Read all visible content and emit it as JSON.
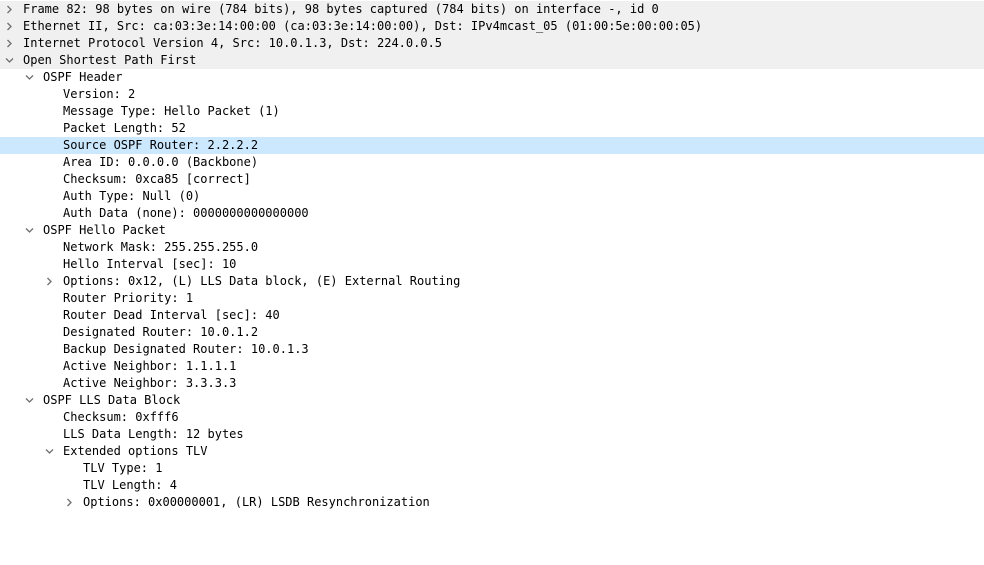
{
  "rows": [
    {
      "id": "frame",
      "text": "Frame 82: 98 bytes on wire (784 bits), 98 bytes captured (784 bits) on interface -, id 0",
      "depth": 0,
      "expander": "collapsed",
      "selected": false,
      "shaded": true
    },
    {
      "id": "ethernet",
      "text": "Ethernet II, Src: ca:03:3e:14:00:00 (ca:03:3e:14:00:00), Dst: IPv4mcast_05 (01:00:5e:00:00:05)",
      "depth": 0,
      "expander": "collapsed",
      "selected": false,
      "shaded": true
    },
    {
      "id": "ipv4",
      "text": "Internet Protocol Version 4, Src: 10.0.1.3, Dst: 224.0.0.5",
      "depth": 0,
      "expander": "collapsed",
      "selected": false,
      "shaded": true
    },
    {
      "id": "ospf",
      "text": "Open Shortest Path First",
      "depth": 0,
      "expander": "expanded",
      "selected": false,
      "shaded": true
    },
    {
      "id": "ospf-header",
      "text": "OSPF Header",
      "depth": 1,
      "expander": "expanded",
      "selected": false
    },
    {
      "id": "version",
      "text": "Version: 2",
      "depth": 2,
      "expander": "none",
      "selected": false
    },
    {
      "id": "message-type",
      "text": "Message Type: Hello Packet (1)",
      "depth": 2,
      "expander": "none",
      "selected": false
    },
    {
      "id": "packet-length",
      "text": "Packet Length: 52",
      "depth": 2,
      "expander": "none",
      "selected": false
    },
    {
      "id": "source-router",
      "text": "Source OSPF Router: 2.2.2.2",
      "depth": 2,
      "expander": "none",
      "selected": true
    },
    {
      "id": "area-id",
      "text": "Area ID: 0.0.0.0 (Backbone)",
      "depth": 2,
      "expander": "none",
      "selected": false
    },
    {
      "id": "checksum",
      "text": "Checksum: 0xca85 [correct]",
      "depth": 2,
      "expander": "none",
      "selected": false
    },
    {
      "id": "auth-type",
      "text": "Auth Type: Null (0)",
      "depth": 2,
      "expander": "none",
      "selected": false
    },
    {
      "id": "auth-data",
      "text": "Auth Data (none): 0000000000000000",
      "depth": 2,
      "expander": "none",
      "selected": false
    },
    {
      "id": "hello-packet",
      "text": "OSPF Hello Packet",
      "depth": 1,
      "expander": "expanded",
      "selected": false
    },
    {
      "id": "network-mask",
      "text": "Network Mask: 255.255.255.0",
      "depth": 2,
      "expander": "none",
      "selected": false
    },
    {
      "id": "hello-interval",
      "text": "Hello Interval [sec]: 10",
      "depth": 2,
      "expander": "none",
      "selected": false
    },
    {
      "id": "options",
      "text": "Options: 0x12, (L) LLS Data block, (E) External Routing",
      "depth": 2,
      "expander": "collapsed",
      "selected": false
    },
    {
      "id": "router-priority",
      "text": "Router Priority: 1",
      "depth": 2,
      "expander": "none",
      "selected": false
    },
    {
      "id": "dead-interval",
      "text": "Router Dead Interval [sec]: 40",
      "depth": 2,
      "expander": "none",
      "selected": false
    },
    {
      "id": "designated-router",
      "text": "Designated Router: 10.0.1.2",
      "depth": 2,
      "expander": "none",
      "selected": false
    },
    {
      "id": "backup-designated-router",
      "text": "Backup Designated Router: 10.0.1.3",
      "depth": 2,
      "expander": "none",
      "selected": false
    },
    {
      "id": "active-neighbor-1",
      "text": "Active Neighbor: 1.1.1.1",
      "depth": 2,
      "expander": "none",
      "selected": false
    },
    {
      "id": "active-neighbor-2",
      "text": "Active Neighbor: 3.3.3.3",
      "depth": 2,
      "expander": "none",
      "selected": false
    },
    {
      "id": "lls-block",
      "text": "OSPF LLS Data Block",
      "depth": 1,
      "expander": "expanded",
      "selected": false
    },
    {
      "id": "lls-checksum",
      "text": "Checksum: 0xfff6",
      "depth": 2,
      "expander": "none",
      "selected": false
    },
    {
      "id": "lls-length",
      "text": "LLS Data Length: 12 bytes",
      "depth": 2,
      "expander": "none",
      "selected": false
    },
    {
      "id": "ext-options-tlv",
      "text": "Extended options TLV",
      "depth": 2,
      "expander": "expanded",
      "selected": false
    },
    {
      "id": "tlv-type",
      "text": "TLV Type: 1",
      "depth": 3,
      "expander": "none",
      "selected": false
    },
    {
      "id": "tlv-length",
      "text": "TLV Length: 4",
      "depth": 3,
      "expander": "none",
      "selected": false
    },
    {
      "id": "lsdb-options",
      "text": "Options: 0x00000001, (LR) LSDB Resynchronization",
      "depth": 3,
      "expander": "collapsed",
      "selected": false
    }
  ]
}
